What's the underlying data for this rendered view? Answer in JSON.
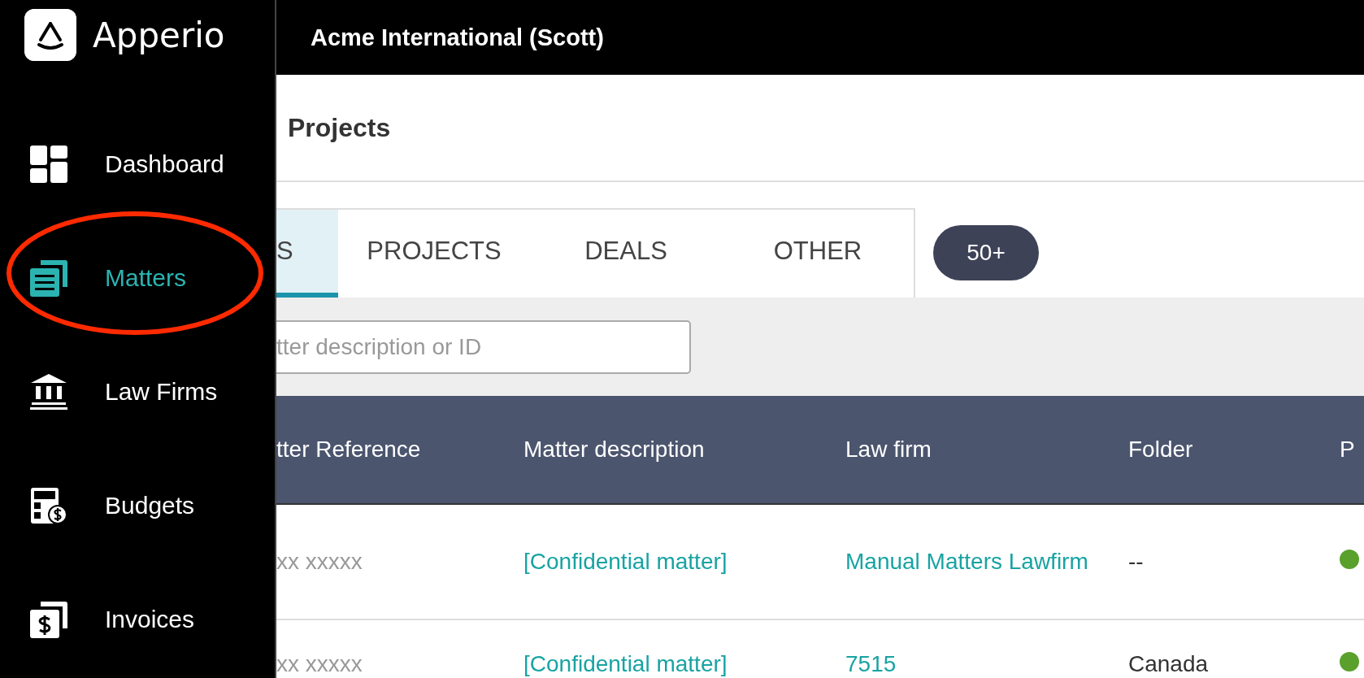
{
  "sidebar": {
    "brand": "Apperio",
    "items": [
      {
        "label": "Dashboard",
        "selected": false
      },
      {
        "label": "Matters",
        "selected": true
      },
      {
        "label": "Law Firms",
        "selected": false
      },
      {
        "label": "Budgets",
        "selected": false
      },
      {
        "label": "Invoices",
        "selected": false
      }
    ]
  },
  "header": {
    "account": "Acme International (Scott)"
  },
  "page": {
    "title": "Projects"
  },
  "tabs": [
    {
      "label": "S",
      "selected": true
    },
    {
      "label": "PROJECTS",
      "selected": false
    },
    {
      "label": "DEALS",
      "selected": false
    },
    {
      "label": "OTHER",
      "selected": false
    }
  ],
  "count_badge": "50+",
  "search": {
    "placeholder": "tter description or ID"
  },
  "table": {
    "columns": [
      "tter Reference",
      "Matter description",
      "Law firm",
      "Folder",
      "P"
    ],
    "rows": [
      {
        "reference": "xx xxxxx",
        "description": "[Confidential matter]",
        "law_firm": "Manual Matters Lawfirm",
        "folder": "--",
        "color": "#5aa02c"
      },
      {
        "reference": "xx xxxxx",
        "description": "[Confidential matter]",
        "law_firm": "7515",
        "folder": "Canada",
        "color": "#5aa02c"
      }
    ]
  }
}
